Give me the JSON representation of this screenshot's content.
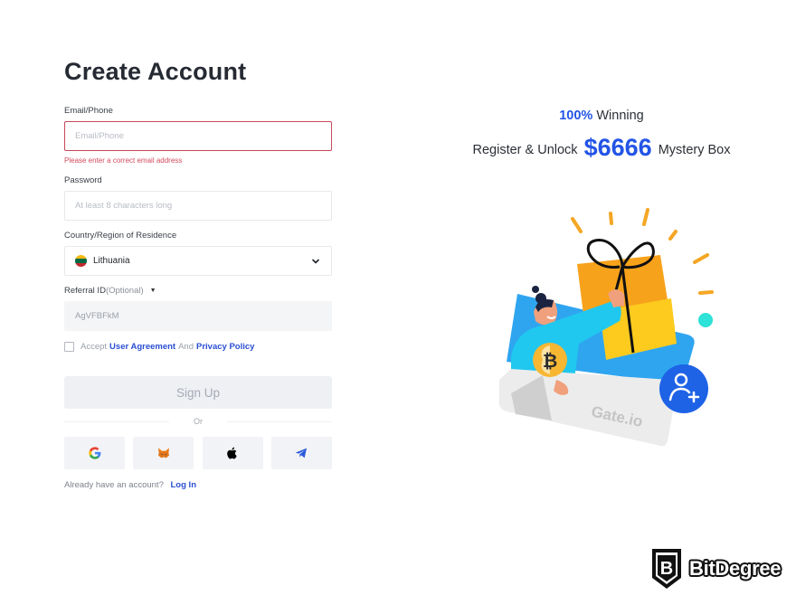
{
  "form": {
    "title": "Create Account",
    "email": {
      "label": "Email/Phone",
      "placeholder": "Email/Phone",
      "value": "",
      "error": "Please enter a correct email address"
    },
    "password": {
      "label": "Password",
      "placeholder": "At least 8 characters long",
      "value": ""
    },
    "country": {
      "label": "Country/Region of Residence",
      "selected": "Lithuania",
      "flag_colors": [
        "#fdb913",
        "#006a44",
        "#c1272d"
      ]
    },
    "referral": {
      "label": "Referral ID",
      "optional": "(Optional)",
      "placeholder": "AgVFBFkM",
      "value": ""
    },
    "agreement": {
      "accept": "Accept",
      "user_agreement": "User Agreement",
      "and": "And",
      "privacy_policy": "Privacy Policy",
      "checked": false
    },
    "signup_label": "Sign Up",
    "or_label": "Or",
    "social": [
      {
        "name": "google",
        "icon": "google-icon"
      },
      {
        "name": "metamask",
        "icon": "metamask-fox-icon"
      },
      {
        "name": "apple",
        "icon": "apple-icon"
      },
      {
        "name": "telegram",
        "icon": "telegram-icon"
      }
    ],
    "login_prompt": "Already have an account?",
    "login_link": "Log In"
  },
  "promo": {
    "percent": "100%",
    "winning": "Winning",
    "register_text": "Register & Unlock",
    "amount": "$6666",
    "box_text": "Mystery Box",
    "card_brand": "Gate.io"
  },
  "watermark": {
    "name": "BitDegree",
    "letter": "B"
  },
  "colors": {
    "accent": "#2354e6",
    "link": "#2a4fd2",
    "error": "#d34a5e"
  }
}
